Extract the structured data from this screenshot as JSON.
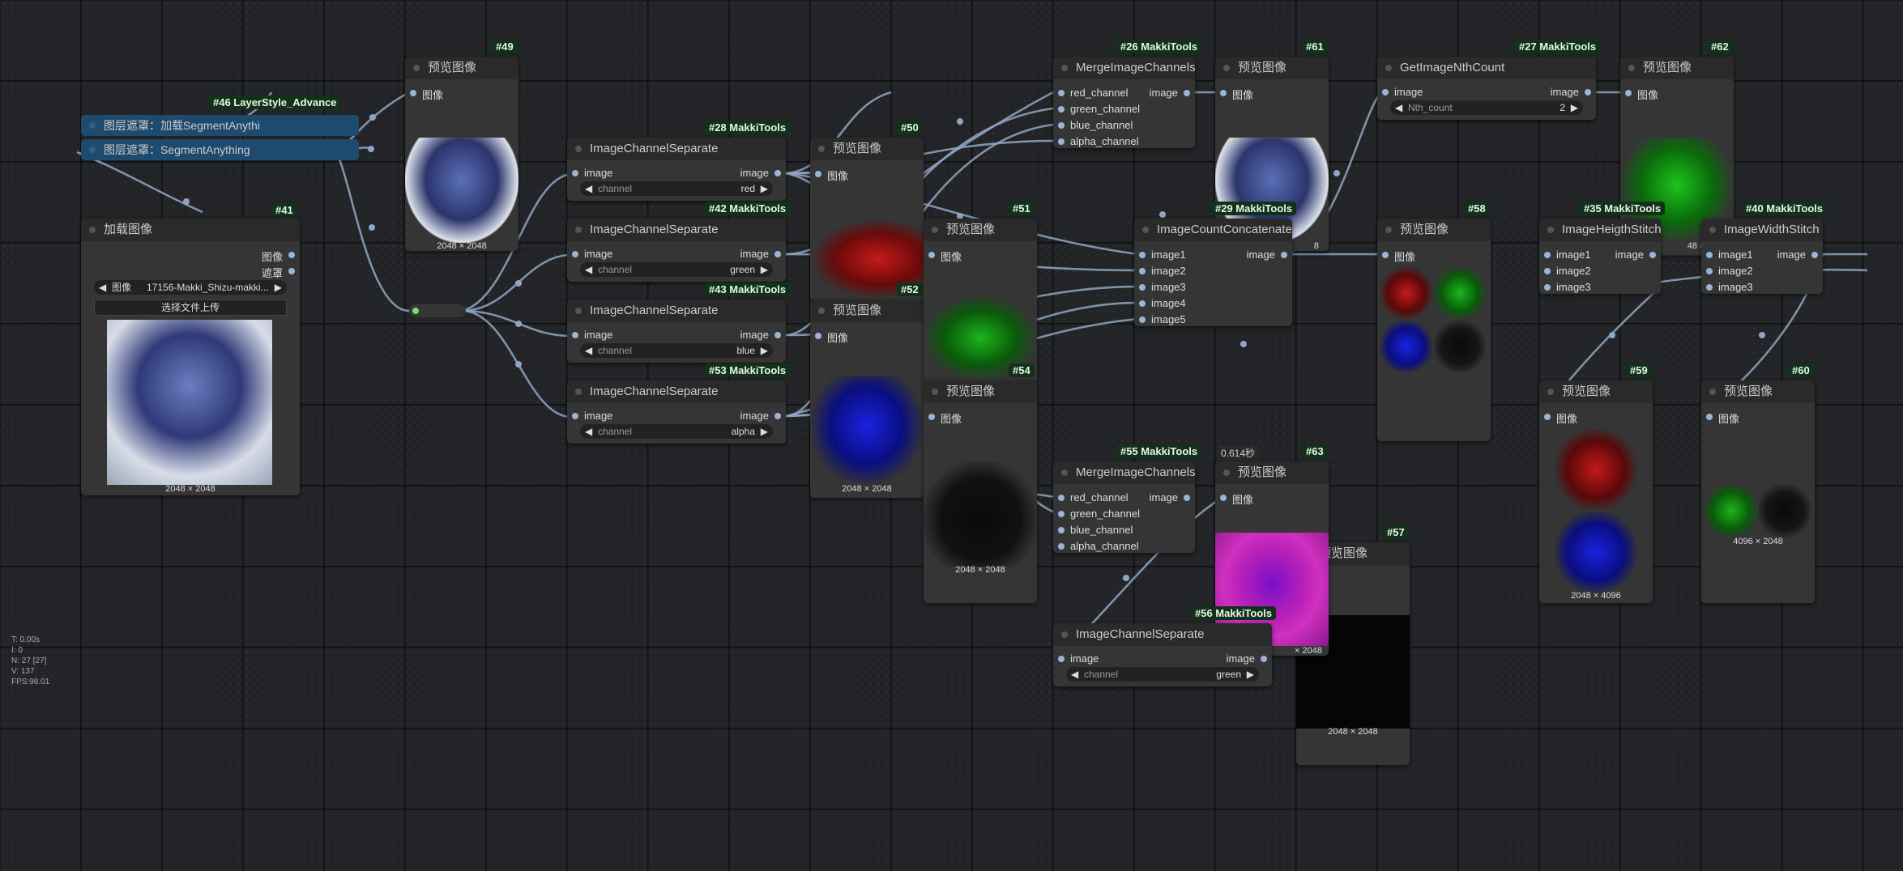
{
  "labels": {
    "preview": "预览图像",
    "image_cn": "图像",
    "mask_cn": "遮罩",
    "image": "image",
    "channel": "channel",
    "red_channel": "red_channel",
    "green_channel": "green_channel",
    "blue_channel": "blue_channel",
    "alpha_channel": "alpha_channel",
    "image1": "image1",
    "image2": "image2",
    "image3": "image3",
    "image4": "image4",
    "image5": "image5",
    "size_2048": "2048 × 2048",
    "size_2048_partial": "48 × 2048",
    "size_2048_partial2": "× 2048",
    "size_2048_tail": "8",
    "size_4096w": "4096 × 2048",
    "size_4096h": "2048 × 4096"
  },
  "badges": {
    "n49": "#49",
    "n46": "#46 LayerStyle_Advance",
    "n41": "#41",
    "n28": "#28 MakkiTools",
    "n42": "#42 MakkiTools",
    "n43": "#43 MakkiTools",
    "n53": "#53 MakkiTools",
    "n50": "#50",
    "n52": "#52",
    "n51": "#51",
    "n54": "#54",
    "n26": "#26 MakkiTools",
    "n61": "#61",
    "n29": "#29 MakkiTools",
    "n55": "#55 MakkiTools",
    "n63": "#63",
    "n56": "#56 MakkiTools",
    "n57": "#57",
    "n27": "#27 MakkiTools",
    "n62": "#62",
    "n58": "#58",
    "n35": "#35 MakkiTools",
    "n40": "#40 MakkiTools",
    "n59": "#59",
    "n60": "#60"
  },
  "nodes": {
    "load_image": {
      "title": "加载图像",
      "file": "17156-Makki_Shizu-makki...",
      "upload": "选择文件上传"
    },
    "segment1": "图层遮罩：加载SegmentAnythi",
    "segment2": "图层遮罩：SegmentAnything",
    "ics": "ImageChannelSeparate",
    "mic": "MergeImageChannels",
    "icc": "ImageCountConcatenate",
    "ginth": "GetImageNthCount",
    "nth_label": "Nth_count",
    "nth_value": "2",
    "heigth": "ImageHeigthStitch",
    "width": "ImageWidthStitch",
    "ch_red": "red",
    "ch_green": "green",
    "ch_blue": "blue",
    "ch_alpha": "alpha"
  },
  "time_tag": "0.614秒",
  "stats": [
    "T: 0.00s",
    "I: 0",
    "N: 27 [27]",
    "V: 137",
    "FPS:98.01"
  ],
  "colors": {
    "link": "#8fa6c2",
    "badge_bg": "#12301a",
    "node_bg": "#353535",
    "title_bg": "#2a2a2a",
    "segment_bg": "#1e4a6e"
  }
}
